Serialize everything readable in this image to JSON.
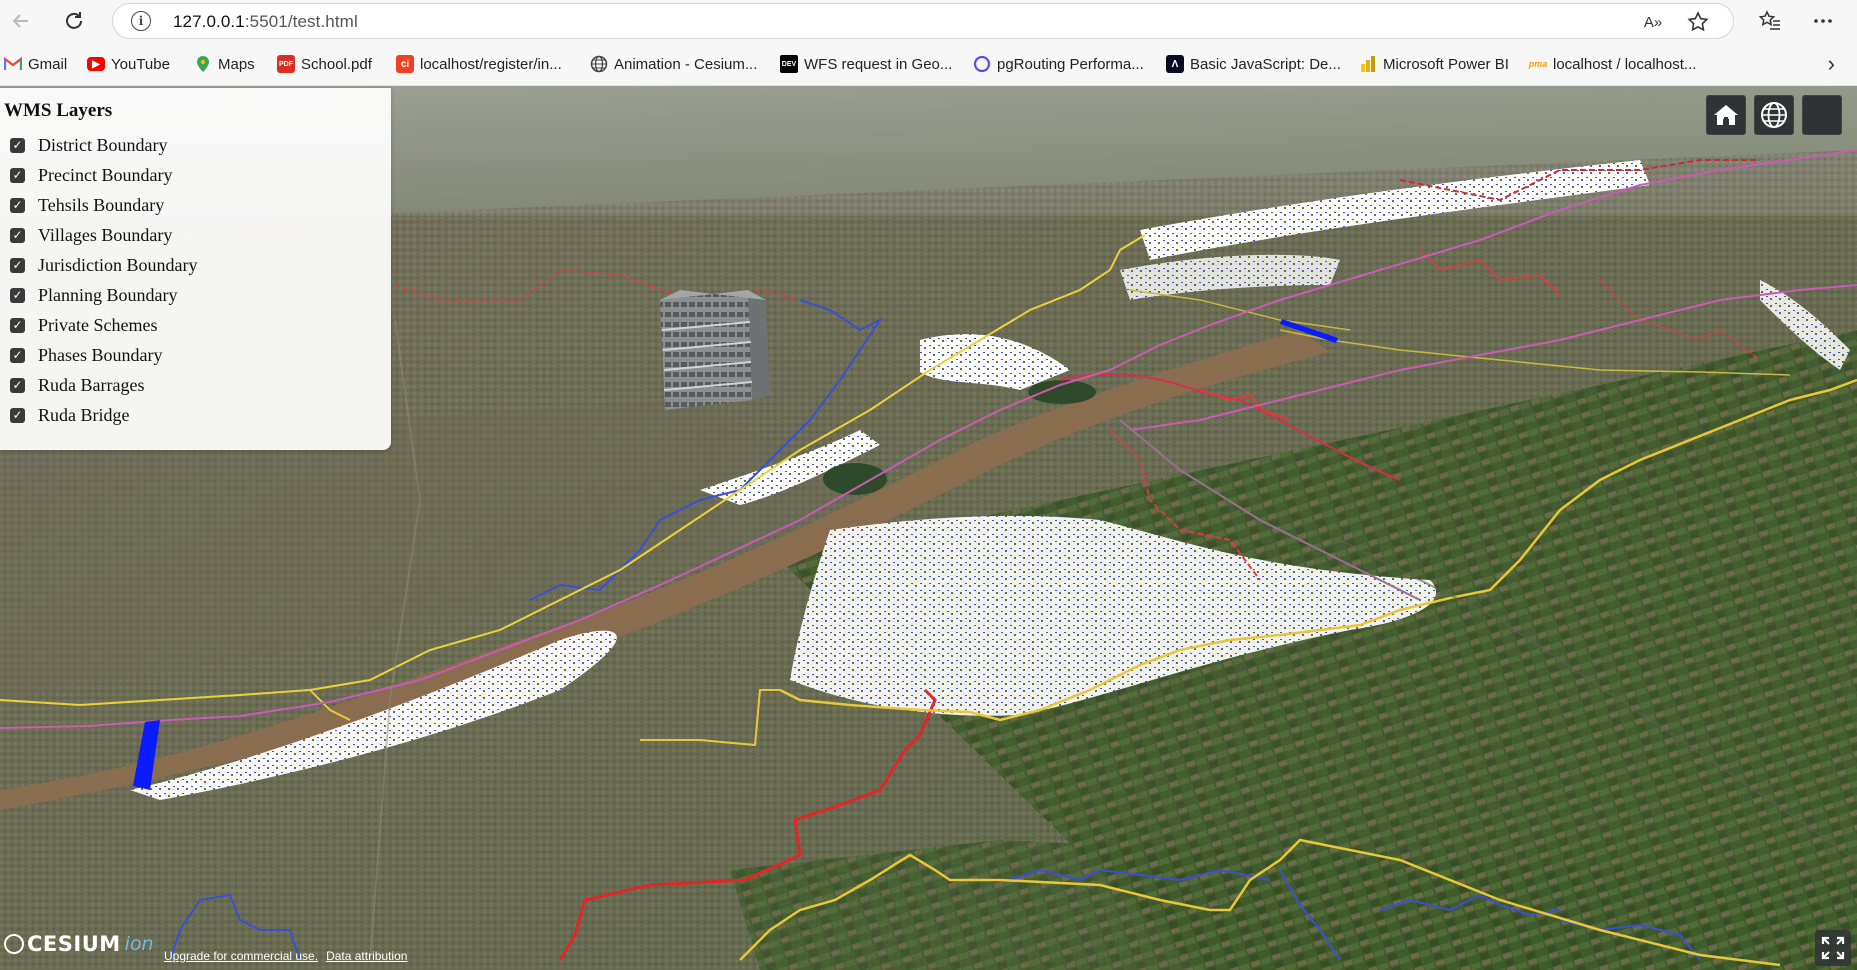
{
  "browser": {
    "url_host": "127.0.0.1",
    "url_path": ":5501/test.html",
    "read_aloud_label": "A»"
  },
  "bookmarks": [
    {
      "label": "Gmail",
      "icon": "gmail-icon",
      "color": "#ea4335"
    },
    {
      "label": "YouTube",
      "icon": "youtube-icon",
      "color": "#ff0000"
    },
    {
      "label": "Maps",
      "icon": "maps-pin-icon",
      "color": "#34a853"
    },
    {
      "label": "School.pdf",
      "icon": "pdf-icon",
      "color": "#d93025"
    },
    {
      "label": "localhost/register/in...",
      "icon": "codeigniter-icon",
      "color": "#ee4323"
    },
    {
      "label": "Animation - Cesium...",
      "icon": "globe-icon",
      "color": "#444444"
    },
    {
      "label": "WFS request in Geo...",
      "icon": "dev-icon",
      "color": "#000000"
    },
    {
      "label": "pgRouting Performa...",
      "icon": "ring-icon",
      "color": "#5b4ee8"
    },
    {
      "label": "Basic JavaScript: De...",
      "icon": "freecodecamp-icon",
      "color": "#0a0a23"
    },
    {
      "label": "Microsoft Power BI",
      "icon": "powerbi-icon",
      "color": "#f2c811"
    },
    {
      "label": "localhost / localhost...",
      "icon": "phpmyadmin-icon",
      "color": "#f89c0e"
    }
  ],
  "panel": {
    "title": "WMS Layers",
    "layers": [
      {
        "label": "District Boundary",
        "checked": true
      },
      {
        "label": "Precinct Boundary",
        "checked": true
      },
      {
        "label": "Tehsils Boundary",
        "checked": true
      },
      {
        "label": "Villages Boundary",
        "checked": true
      },
      {
        "label": "Jurisdiction Boundary",
        "checked": true
      },
      {
        "label": "Planning Boundary",
        "checked": true
      },
      {
        "label": "Private Schemes",
        "checked": true
      },
      {
        "label": "Phases Boundary",
        "checked": true
      },
      {
        "label": "Ruda Barrages",
        "checked": true
      },
      {
        "label": "Ruda Bridge",
        "checked": true
      }
    ]
  },
  "viewer": {
    "logo_text": "CESIUM",
    "logo_suffix": "ion",
    "credit_upgrade": "Upgrade for commercial use.",
    "credit_attribution": "Data attribution",
    "colors": {
      "district": "#e23a3a",
      "villages": "#3a4fd8",
      "planning": "#e0c23a",
      "phases": "#c85ab8",
      "barrage": "#0a1cff",
      "river": "#8a6d4e"
    }
  }
}
